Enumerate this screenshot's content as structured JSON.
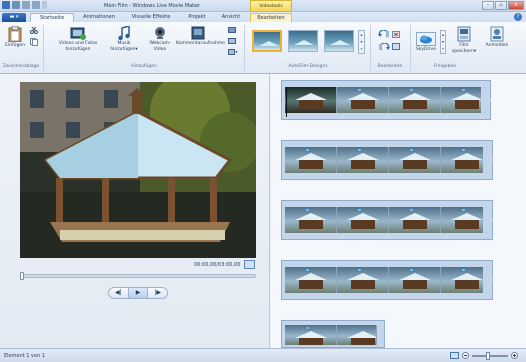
{
  "window": {
    "title": "Mein Film - Windows Live Movie Maker",
    "context_tab_group": "Videotools"
  },
  "tabs": [
    {
      "label": "Startseite",
      "active": true
    },
    {
      "label": "Animationen"
    },
    {
      "label": "Visuelle Effekte"
    },
    {
      "label": "Projekt"
    },
    {
      "label": "Ansicht"
    },
    {
      "label": "Bearbeiten",
      "context": true
    }
  ],
  "ribbon": {
    "clipboard": {
      "paste": "Einfügen",
      "group": "Zwischenablage"
    },
    "add": {
      "videos_photos": "Videos und Fotos hinzufügen",
      "music": "Musik hinzufügen",
      "webcam": "Webcam-Video",
      "narration": "Kommentaraufnahme",
      "group": "Hinzufügen"
    },
    "autofilm": {
      "group": "AutoFilm-Designs"
    },
    "edit": {
      "group": "Bearbeiten"
    },
    "share": {
      "skydrive": "SkyDrive",
      "save": "Film speichern",
      "signin": "Anmelden",
      "group": "Freigeben"
    }
  },
  "preview": {
    "timecode": "00:00,00/03:00,00",
    "controls": {
      "prev": "◀|",
      "play": "▶",
      "next": "|▶"
    }
  },
  "status": {
    "text": "Element 1 von 1"
  },
  "colors": {
    "accent": "#1c4f9c",
    "context": "#f6d65a",
    "clip_bg": "#c3d6ec"
  }
}
